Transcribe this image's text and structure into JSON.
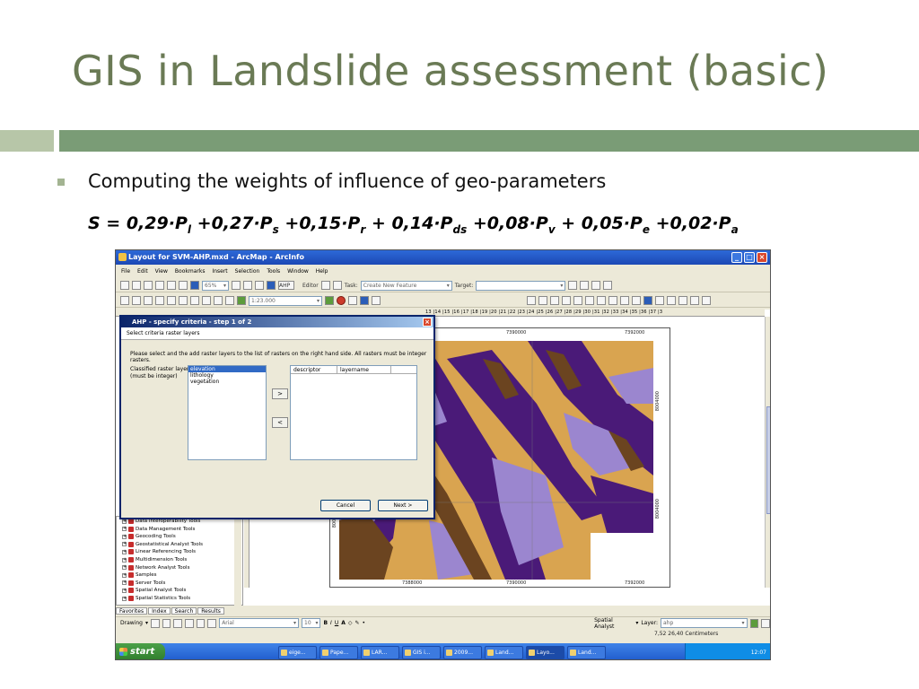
{
  "slide": {
    "title": "GIS in Landslide assessment (basic)",
    "bullet": "Computing the weights of influence of geo-parameters",
    "formula": {
      "lhs": "S = ",
      "terms": [
        {
          "coef": "0,29",
          "sub": "l",
          "sep": " +"
        },
        {
          "coef": "0,27",
          "sub": "s",
          "sep": " +"
        },
        {
          "coef": "0,15",
          "sub": "r",
          "sep": " + "
        },
        {
          "coef": "0,14",
          "sub": "ds",
          "sep": " +"
        },
        {
          "coef": "0,08",
          "sub": "v",
          "sep": " + "
        },
        {
          "coef": "0,05",
          "sub": "e",
          "sep": " +"
        },
        {
          "coef": "0,02",
          "sub": "a",
          "sep": ""
        }
      ],
      "var": "P"
    }
  },
  "app": {
    "window_title": "Layout for SVM-AHP.mxd - ArcMap - ArcInfo",
    "menu": [
      "File",
      "Edit",
      "View",
      "Bookmarks",
      "Insert",
      "Selection",
      "Tools",
      "Window",
      "Help"
    ],
    "zoom": "65%",
    "ahp_button": "AHP",
    "editor_label": "Editor",
    "task_label": "Task:",
    "task_value": "Create New Feature",
    "target_label": "Target:",
    "scale_value": "1:23.000",
    "ruler_ticks": "13 |14 |15 |16 |17 |18 |19 |20 |21 |22 |23 |24 |25 |26 |27 |28 |29 |30 |31 |32 |33 |34 |35 |36 |37 |3",
    "map_coords": {
      "top": [
        "7390000",
        "7392000"
      ],
      "bottom": [
        "7388000",
        "7390000",
        "7392000"
      ],
      "right": [
        "8004000",
        "8004000"
      ],
      "left": [
        "8004000"
      ]
    }
  },
  "dialog": {
    "title": "AHP - specify criteria - step 1 of 2",
    "header": "Select criteria raster layers",
    "instruction": "Please select and the add raster layers to the list of rasters on the right hand side. All rasters must be integer rasters.",
    "classified_label": "Classified raster layers",
    "classified_note": "(must be integer)",
    "layers": [
      "elevation",
      "lithology",
      "vegetation"
    ],
    "selected_index": 0,
    "add_arrow": ">",
    "remove_arrow": "<",
    "columns": [
      "descriptor",
      "layername"
    ],
    "cancel": "Cancel",
    "next": "Next >"
  },
  "toolbox": {
    "items": [
      "Data Interoperability Tools",
      "Data Management Tools",
      "Geocoding Tools",
      "Geostatistical Analyst Tools",
      "Linear Referencing Tools",
      "Multidimension Tools",
      "Network Analyst Tools",
      "Samples",
      "Server Tools",
      "Spatial Analyst Tools",
      "Spatial Statistics Tools"
    ],
    "tabs": [
      "Favorites",
      "Index",
      "Search",
      "Results"
    ]
  },
  "drawbar": {
    "drawing": "Drawing",
    "font": "Arial",
    "size": "10",
    "spatial_analyst": "Spatial Analyst",
    "layer_label": "Layer:",
    "layer_value": "ahp"
  },
  "status": "7,52  26,40 Centimeters",
  "taskbar": {
    "start": "start",
    "tasks": [
      "eige...",
      "Pape...",
      "LAR...",
      "GIS i...",
      "2009...",
      "Land...",
      "Layo...",
      "Land..."
    ],
    "active_index": 6,
    "clock": "12:07"
  },
  "colors": {
    "title": "#6a7a55",
    "band_light": "#b7c6a8",
    "band_dark": "#7a9c76",
    "map_purple": "#4a1a78",
    "map_lavender": "#9b86cf",
    "map_tan": "#d9a450",
    "map_brown": "#6b4420"
  }
}
